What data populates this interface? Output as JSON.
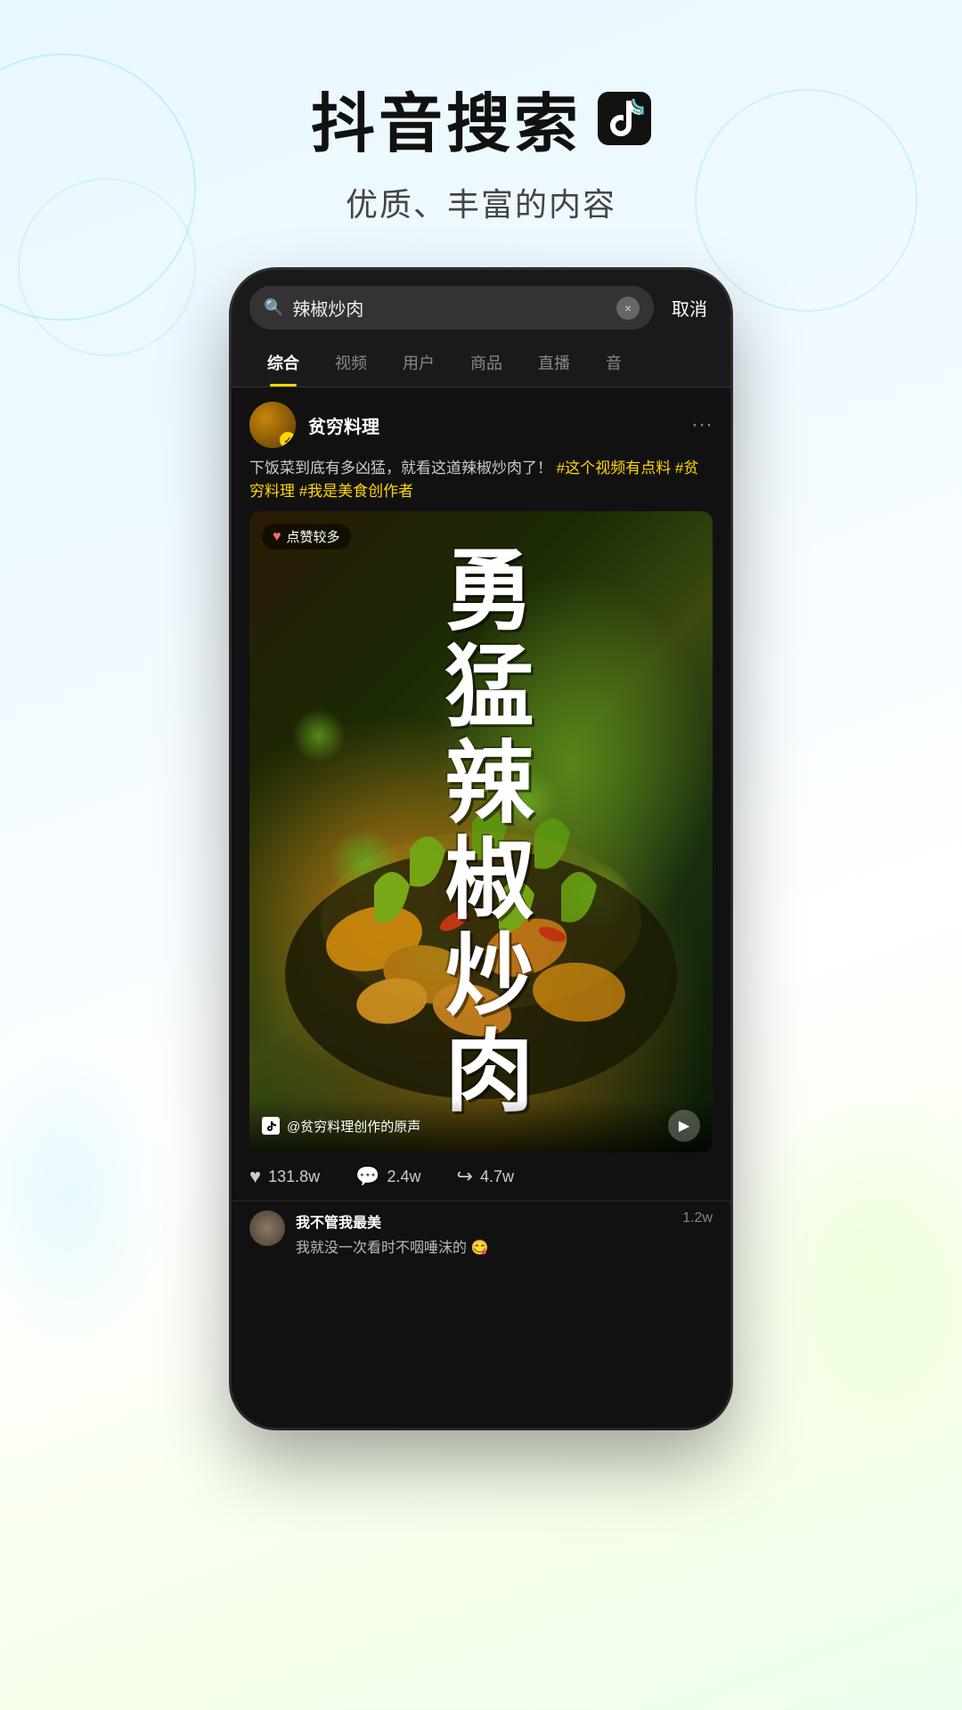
{
  "header": {
    "title": "抖音搜索",
    "subtitle": "优质、丰富的内容",
    "logo_alt": "tiktok-logo"
  },
  "search": {
    "query": "辣椒炒肉",
    "cancel_label": "取消",
    "clear_icon": "×"
  },
  "tabs": [
    {
      "label": "综合",
      "active": true
    },
    {
      "label": "视频",
      "active": false
    },
    {
      "label": "用户",
      "active": false
    },
    {
      "label": "商品",
      "active": false
    },
    {
      "label": "直播",
      "active": false
    },
    {
      "label": "音",
      "active": false
    }
  ],
  "result": {
    "user": {
      "name": "贫穷料理",
      "verified": true
    },
    "post_text": "下饭菜到底有多凶猛，就看这道辣椒炒肉了！",
    "hashtags": "#这个视频有点料 #贫穷料理 #我是美食创作者",
    "hot_badge": "点赞较多",
    "video_title": "勇\n猛\n辣\n椒\n炒\n肉",
    "sound_info": "@贫穷料理创作的原声",
    "stats": {
      "likes": "131.8w",
      "comments": "2.4w",
      "shares": "4.7w"
    },
    "comment": {
      "user_name": "我不管我最美",
      "text": "我就没一次看时不咽唾沫的 😋",
      "count": "1.2w"
    }
  }
}
